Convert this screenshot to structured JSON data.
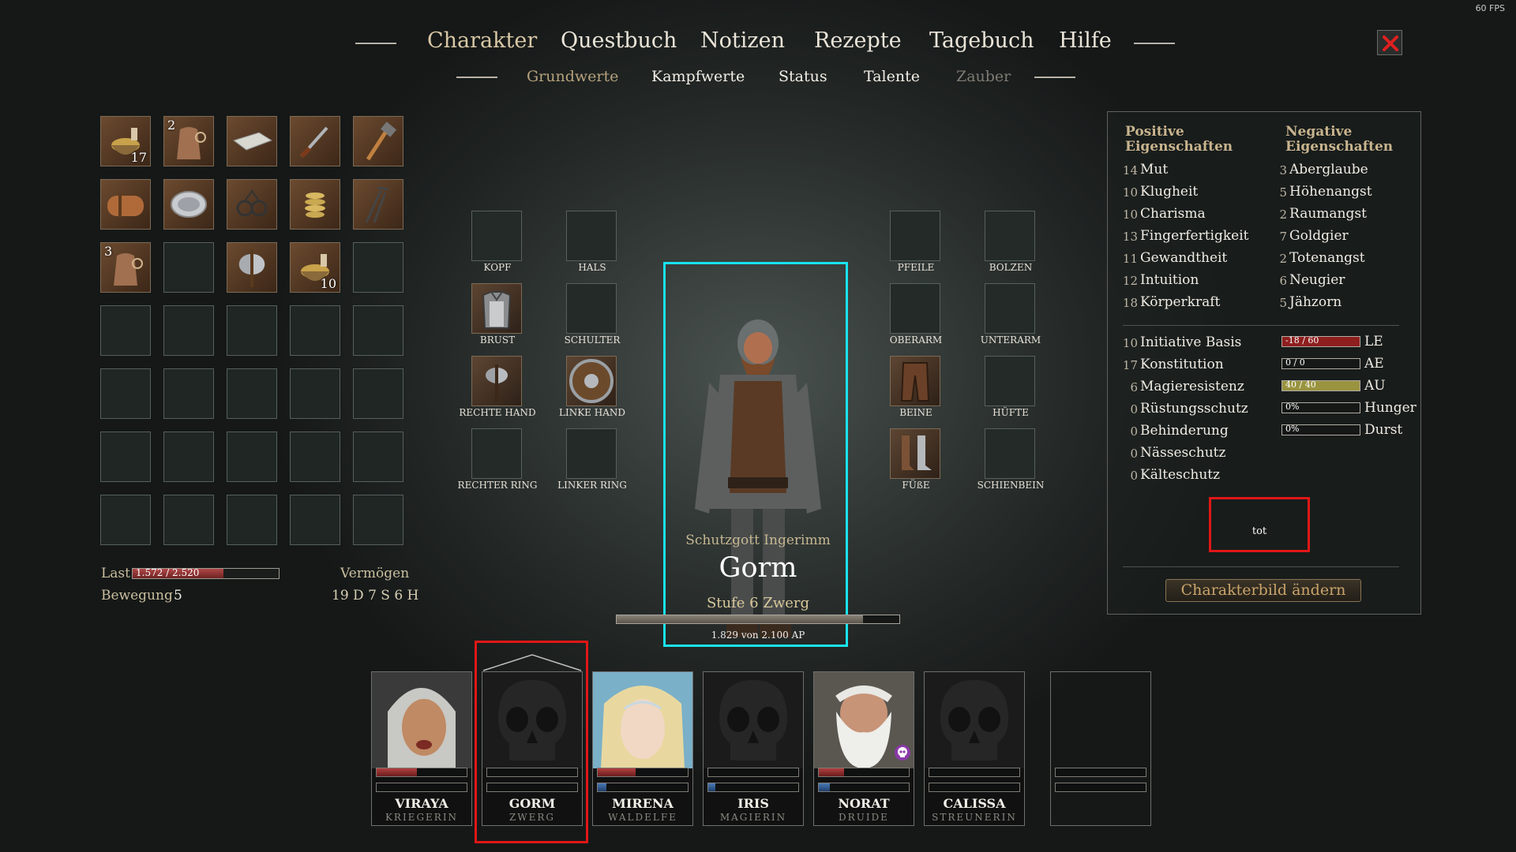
{
  "fps": "60 FPS",
  "tabs": [
    {
      "label": "Charakter",
      "active": true
    },
    {
      "label": "Questbuch"
    },
    {
      "label": "Notizen"
    },
    {
      "label": "Rezepte"
    },
    {
      "label": "Tagebuch"
    },
    {
      "label": "Hilfe"
    }
  ],
  "subtabs": [
    {
      "label": "Grundwerte",
      "active": true
    },
    {
      "label": "Kampfwerte"
    },
    {
      "label": "Status"
    },
    {
      "label": "Talente"
    },
    {
      "label": "Zauber",
      "disabled": true
    }
  ],
  "inventory": {
    "slots": [
      {
        "icon": "bowl-icon",
        "count": "17"
      },
      {
        "icon": "sack-icon",
        "count": "2"
      },
      {
        "icon": "cloth-icon"
      },
      {
        "icon": "dagger-icon"
      },
      {
        "icon": "hammer-icon"
      },
      {
        "icon": "bedroll-icon"
      },
      {
        "icon": "plate-icon"
      },
      {
        "icon": "shackles-icon"
      },
      {
        "icon": "rope-icon"
      },
      {
        "icon": "tongs-icon"
      },
      {
        "icon": "sack-icon",
        "count": "3"
      },
      {},
      {
        "icon": "battleaxe-icon"
      },
      {
        "icon": "bowl-icon",
        "count": "10"
      },
      {}
    ],
    "last_label": "Last",
    "last_value": "1.572 / 2.520",
    "last_fraction": 0.624,
    "movement_label": "Bewegung",
    "movement_value": "5",
    "wealth_label": "Vermögen",
    "wealth_value": "19 D 7 S 6 H"
  },
  "equipment": {
    "kopf": "KOPF",
    "hals": "HALS",
    "brust": "BRUST",
    "schulter": "SCHULTER",
    "rechte_hand": "RECHTE HAND",
    "linke_hand": "LINKE HAND",
    "rechter_ring": "RECHTER RING",
    "linker_ring": "LINKER RING",
    "pfeile": "PFEILE",
    "bolzen": "BOLZEN",
    "oberarm": "OBERARM",
    "unterarm": "UNTERARM",
    "beine": "BEINE",
    "huefte": "HÜFTE",
    "fuesse": "FÜßE",
    "schienbein": "SCHIENBEIN"
  },
  "character": {
    "deity": "Schutzgott Ingerimm",
    "name": "Gorm",
    "level": "Stufe 6 Zwerg",
    "ap_text": "1.829 von 2.100 AP",
    "ap_fraction": 0.871
  },
  "stats": {
    "positive_header": "Positive Eigenschaften",
    "negative_header": "Negative Eigenschaften",
    "positive": [
      {
        "v": "14",
        "n": "Mut"
      },
      {
        "v": "10",
        "n": "Klugheit"
      },
      {
        "v": "10",
        "n": "Charisma"
      },
      {
        "v": "13",
        "n": "Fingerfertigkeit"
      },
      {
        "v": "11",
        "n": "Gewandtheit"
      },
      {
        "v": "12",
        "n": "Intuition"
      },
      {
        "v": "18",
        "n": "Körperkraft"
      }
    ],
    "negative": [
      {
        "v": "3",
        "n": "Aberglaube"
      },
      {
        "v": "5",
        "n": "Höhenangst"
      },
      {
        "v": "2",
        "n": "Raumangst"
      },
      {
        "v": "7",
        "n": "Goldgier"
      },
      {
        "v": "2",
        "n": "Totenangst"
      },
      {
        "v": "6",
        "n": "Neugier"
      },
      {
        "v": "5",
        "n": "Jähzorn"
      }
    ],
    "derived": [
      {
        "v": "10",
        "n": "Initiative Basis"
      },
      {
        "v": "17",
        "n": "Konstitution"
      },
      {
        "v": "6",
        "n": "Magieresistenz"
      },
      {
        "v": "0",
        "n": "Rüstungsschutz"
      },
      {
        "v": "0",
        "n": "Behinderung"
      },
      {
        "v": "0",
        "n": "Nässeschutz"
      },
      {
        "v": "0",
        "n": "Kälteschutz"
      }
    ],
    "meters": [
      {
        "text": "-18 / 60",
        "label": "LE",
        "fraction": 1.0,
        "color": "#8e1e1e"
      },
      {
        "text": "0 / 0",
        "label": "AE",
        "fraction": 0,
        "color": "#2a5a9a"
      },
      {
        "text": "40 / 40",
        "label": "AU",
        "fraction": 1.0,
        "color": "#9a9440"
      },
      {
        "text": "0%",
        "label": "Hunger",
        "fraction": 0,
        "color": "#777"
      },
      {
        "text": "0%",
        "label": "Durst",
        "fraction": 0,
        "color": "#777"
      }
    ],
    "status": "tot",
    "change_portrait": "Charakterbild ändern"
  },
  "party": [
    {
      "name": "VIRAYA",
      "class": "KRIEGERIN",
      "hp_fraction": 0.45,
      "mp_fraction": 0,
      "portrait": "warrior-portrait"
    },
    {
      "name": "GORM",
      "class": "ZWERG",
      "hp_fraction": 0,
      "mp_fraction": 0,
      "portrait": "skull-icon",
      "selected": true
    },
    {
      "name": "MIRENA",
      "class": "WALDELFE",
      "hp_fraction": 0.42,
      "mp_fraction": 0.1,
      "portrait": "elf-portrait"
    },
    {
      "name": "IRIS",
      "class": "MAGIERIN",
      "hp_fraction": 0,
      "mp_fraction": 0.08,
      "portrait": "skull-icon"
    },
    {
      "name": "NORAT",
      "class": "DRUIDE",
      "hp_fraction": 0.28,
      "mp_fraction": 0.12,
      "portrait": "druid-portrait",
      "status_icon": "skull-icon"
    },
    {
      "name": "CALISSA",
      "class": "STREUNERIN",
      "hp_fraction": 0,
      "mp_fraction": 0,
      "portrait": "skull-icon"
    },
    {
      "name": "",
      "class": "",
      "hp_fraction": 0,
      "mp_fraction": 0,
      "portrait": "empty"
    }
  ],
  "colors": {
    "highlight_cyan": "#19e3ef",
    "highlight_red": "#e01717",
    "gold": "#c8b48e"
  }
}
